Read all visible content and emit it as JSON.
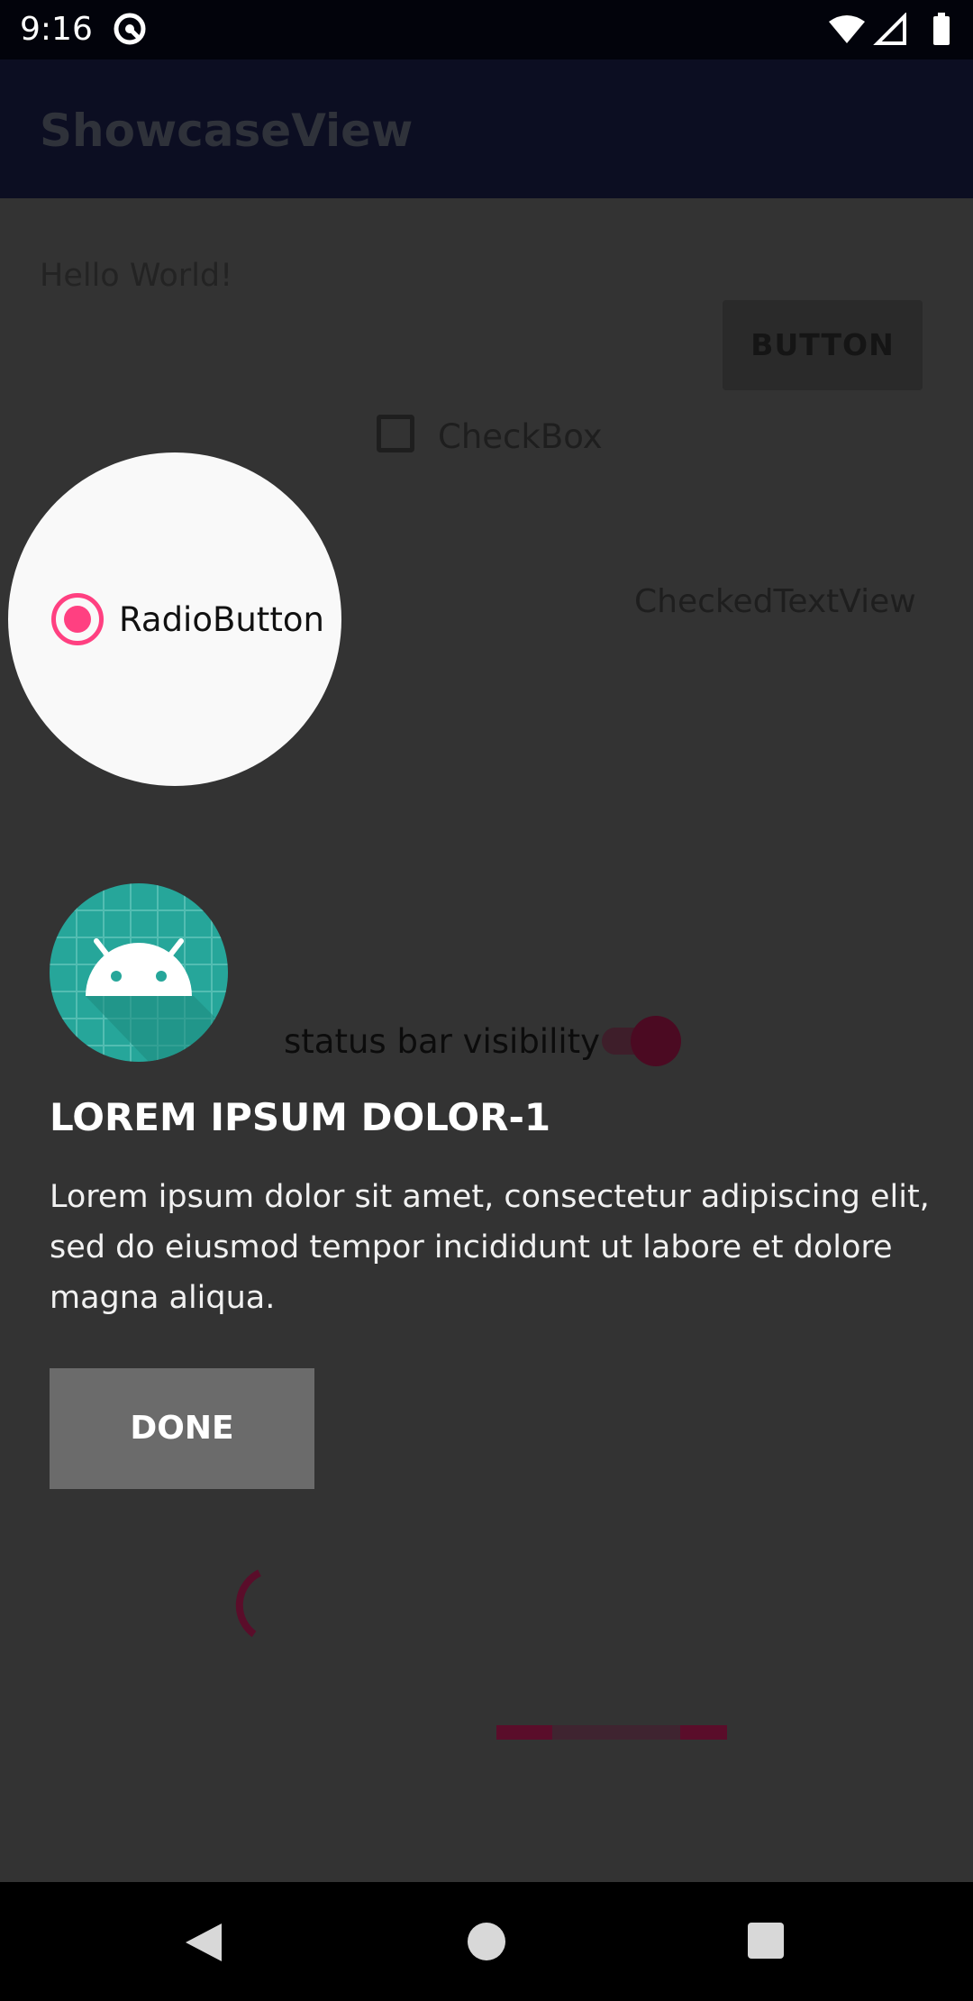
{
  "status_bar": {
    "time": "9:16"
  },
  "app_bar": {
    "title": "ShowcaseView"
  },
  "content": {
    "hello_text": "Hello World!",
    "button_label": "BUTTON",
    "checkbox_label": "CheckBox",
    "radio_label": "RadioButton",
    "checked_text_view": "CheckedTextView",
    "switch_label": "status bar visibility"
  },
  "showcase": {
    "title": "LOREM IPSUM DOLOR-1",
    "description": "Lorem ipsum dolor sit amet, consectetur adipiscing elit, sed do eiusmod tempor incididunt ut labore et dolore magna aliqua.",
    "done_label": "DONE",
    "icon": "android-robot-icon"
  },
  "colors": {
    "accent": "#ff4081",
    "overlay": "#333333",
    "showcase_icon_bg": "#26a69a"
  }
}
